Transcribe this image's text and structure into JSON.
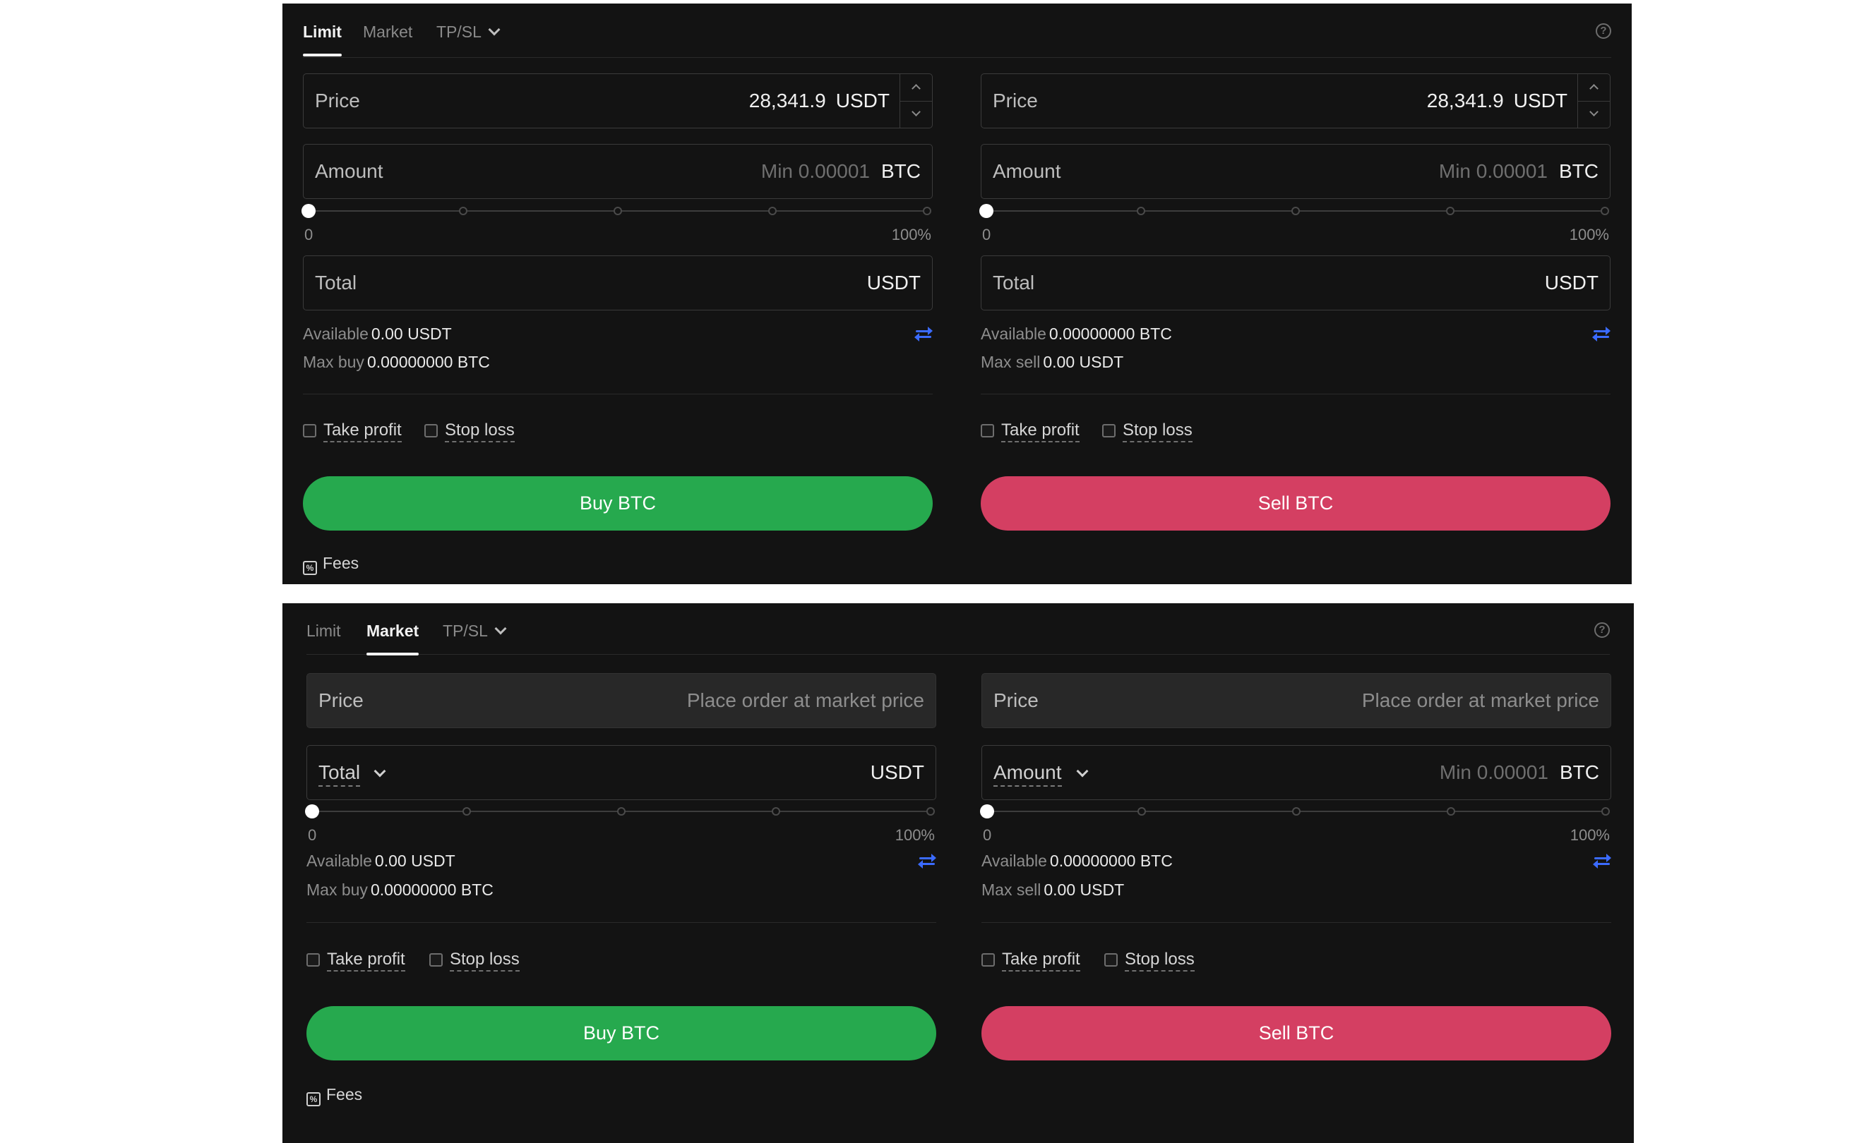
{
  "limit_panel": {
    "tabs": [
      {
        "label": "Limit",
        "active": true
      },
      {
        "label": "Market",
        "active": false
      },
      {
        "label": "TP/SL",
        "active": false
      }
    ],
    "buy": {
      "price_label": "Price",
      "price_value": "28,341.9",
      "price_unit": "USDT",
      "amount_label": "Amount",
      "amount_placeholder": "Min 0.00001",
      "amount_unit": "BTC",
      "slider_min": "0",
      "slider_max": "100%",
      "slider_value_percent": 0,
      "total_label": "Total",
      "total_unit": "USDT",
      "available_label": "Available",
      "available_value": "0.00 USDT",
      "max_label": "Max buy",
      "max_value": "0.00000000 BTC",
      "take_profit": "Take profit",
      "stop_loss": "Stop loss",
      "button": "Buy BTC",
      "fees": "Fees"
    },
    "sell": {
      "price_label": "Price",
      "price_value": "28,341.9",
      "price_unit": "USDT",
      "amount_label": "Amount",
      "amount_placeholder": "Min 0.00001",
      "amount_unit": "BTC",
      "slider_min": "0",
      "slider_max": "100%",
      "slider_value_percent": 0,
      "total_label": "Total",
      "total_unit": "USDT",
      "available_label": "Available",
      "available_value": "0.00000000 BTC",
      "max_label": "Max sell",
      "max_value": "0.00 USDT",
      "take_profit": "Take profit",
      "stop_loss": "Stop loss",
      "button": "Sell BTC"
    }
  },
  "market_panel": {
    "tabs": [
      {
        "label": "Limit",
        "active": false
      },
      {
        "label": "Market",
        "active": true
      },
      {
        "label": "TP/SL",
        "active": false
      }
    ],
    "buy": {
      "price_label": "Price",
      "price_placeholder": "Place order at market price",
      "mode_label": "Total",
      "mode_unit": "USDT",
      "slider_min": "0",
      "slider_max": "100%",
      "slider_value_percent": 0,
      "available_label": "Available",
      "available_value": "0.00 USDT",
      "max_label": "Max buy",
      "max_value": "0.00000000 BTC",
      "take_profit": "Take profit",
      "stop_loss": "Stop loss",
      "button": "Buy BTC",
      "fees": "Fees"
    },
    "sell": {
      "price_label": "Price",
      "price_placeholder": "Place order at market price",
      "mode_label": "Amount",
      "mode_placeholder": "Min 0.00001",
      "mode_unit": "BTC",
      "slider_min": "0",
      "slider_max": "100%",
      "slider_value_percent": 0,
      "available_label": "Available",
      "available_value": "0.00000000 BTC",
      "max_label": "Max sell",
      "max_value": "0.00 USDT",
      "take_profit": "Take profit",
      "stop_loss": "Stop loss",
      "button": "Sell BTC"
    }
  },
  "colors": {
    "panel_bg": "#131313",
    "buy": "#26a94e",
    "sell": "#d43f62",
    "swap_icon": "#3b6bff"
  },
  "icons": [
    "chevron-down-icon",
    "help-circle-icon",
    "stepper-up-icon",
    "stepper-down-icon",
    "swap-icon",
    "checkbox-icon",
    "fees-icon"
  ]
}
